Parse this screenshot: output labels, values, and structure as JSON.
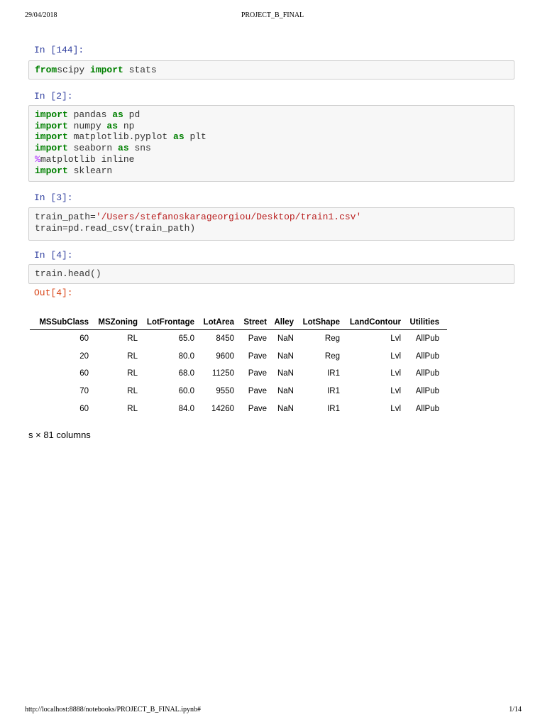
{
  "header": {
    "date": "29/04/2018",
    "title": "PROJECT_B_FINAL"
  },
  "footer": {
    "url": "http://localhost:8888/notebooks/PROJECT_B_FINAL.ipynb#",
    "page": "1/14"
  },
  "cells": [
    {
      "label": "In [144]:",
      "lines": [
        [
          [
            "kw",
            "from"
          ],
          [
            "",
            "scipy "
          ],
          [
            "kw",
            "import"
          ],
          [
            "",
            " stats"
          ]
        ]
      ]
    },
    {
      "label": "In [2]:",
      "lines": [
        [
          [
            "kw",
            "import"
          ],
          [
            "",
            " pandas "
          ],
          [
            "kw",
            "as"
          ],
          [
            "",
            " pd"
          ]
        ],
        [
          [
            "kw",
            "import"
          ],
          [
            "",
            " numpy "
          ],
          [
            "kw",
            "as"
          ],
          [
            "",
            " np"
          ]
        ],
        [
          [
            "kw",
            "import"
          ],
          [
            "",
            " matplotlib.pyplot "
          ],
          [
            "kw",
            "as"
          ],
          [
            "",
            " plt"
          ]
        ],
        [
          [
            "kw",
            "import"
          ],
          [
            "",
            " seaborn "
          ],
          [
            "kw",
            "as"
          ],
          [
            "",
            " sns"
          ]
        ],
        [
          [
            "mg",
            "%"
          ],
          [
            "",
            "matplotlib inline"
          ]
        ],
        [
          [
            "kw",
            "import"
          ],
          [
            "",
            " sklearn"
          ]
        ]
      ]
    },
    {
      "label": "In [3]:",
      "lines": [
        [
          [
            "",
            "train_path="
          ],
          [
            "str",
            "'/Users/stefanoskarageorgiou/Desktop/train1.csv'"
          ]
        ],
        [
          [
            "",
            "train=pd.read_csv(train_path)"
          ]
        ]
      ]
    },
    {
      "label": "In [4]:",
      "lines": [
        [
          [
            "",
            "train.head()"
          ]
        ]
      ]
    }
  ],
  "output": {
    "label": "Out[4]:",
    "columns": [
      "MSSubClass",
      "MSZoning",
      "LotFrontage",
      "LotArea",
      "Street",
      "Alley",
      "LotShape",
      "LandContour",
      "Utilities"
    ],
    "rows": [
      [
        "60",
        "RL",
        "65.0",
        "8450",
        "Pave",
        "NaN",
        "Reg",
        "Lvl",
        "AllPub"
      ],
      [
        "20",
        "RL",
        "80.0",
        "9600",
        "Pave",
        "NaN",
        "Reg",
        "Lvl",
        "AllPub"
      ],
      [
        "60",
        "RL",
        "68.0",
        "11250",
        "Pave",
        "NaN",
        "IR1",
        "Lvl",
        "AllPub"
      ],
      [
        "70",
        "RL",
        "60.0",
        "9550",
        "Pave",
        "NaN",
        "IR1",
        "Lvl",
        "AllPub"
      ],
      [
        "60",
        "RL",
        "84.0",
        "14260",
        "Pave",
        "NaN",
        "IR1",
        "Lvl",
        "AllPub"
      ]
    ],
    "summary": "s × 81 columns"
  }
}
